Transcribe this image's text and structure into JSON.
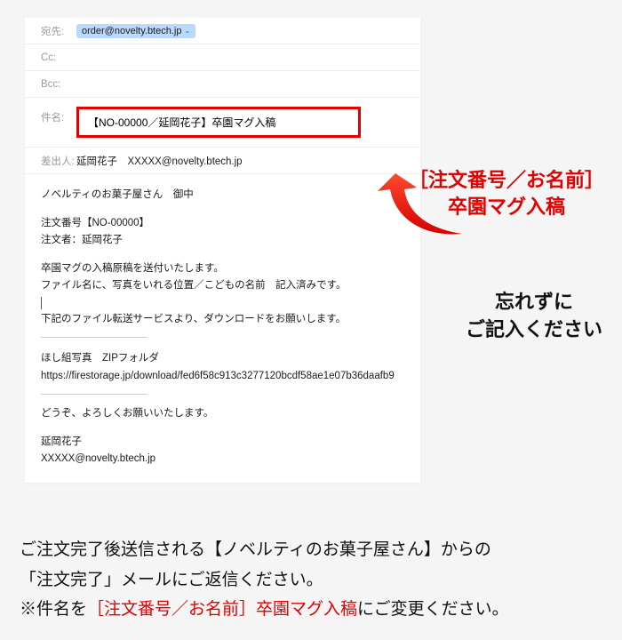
{
  "header": {
    "to_label": "宛先:",
    "to_value": "order@novelty.btech.jp",
    "cc_label": "Cc:",
    "bcc_label": "Bcc:",
    "subject_label": "件名:",
    "subject_value": "【NO-00000／延岡花子】卒園マグ入稿",
    "from_label": "差出人:",
    "from_value": "延岡花子　XXXXX@novelty.btech.jp"
  },
  "body": {
    "greeting": "ノベルティのお菓子屋さん　御中",
    "order_number": "注文番号【NO-00000】",
    "orderer": "注文者：延岡花子",
    "line1": "卒園マグの入稿原稿を送付いたします。",
    "line2": "ファイル名に、写真をいれる位置／こどもの名前　記入済みです。",
    "line3": "下記のファイル転送サービスより、ダウンロードをお願いします。",
    "zip_label": "ほし組写真　ZIPフォルダ",
    "zip_url": "https://firestorage.jp/download/fed6f58c913c3277120bcdf58ae1e07b36daafb9",
    "closing": "どうぞ、よろしくお願いいたします。",
    "sign_name": "延岡花子",
    "sign_email": "XXXXX@novelty.btech.jp"
  },
  "callout1": {
    "line1": "［注文番号／お名前］",
    "line2": "卒園マグ入稿"
  },
  "callout2": {
    "line1": "忘れずに",
    "line2": "ご記入ください"
  },
  "footer": {
    "line1": "ご注文完了後送信される【ノベルティのお菓子屋さん】からの",
    "line2": "「注文完了」メールにご返信ください。",
    "line3a": "※件名を",
    "line3b": "［注文番号／お名前］卒園マグ入稿",
    "line3c": "にご変更ください。"
  }
}
